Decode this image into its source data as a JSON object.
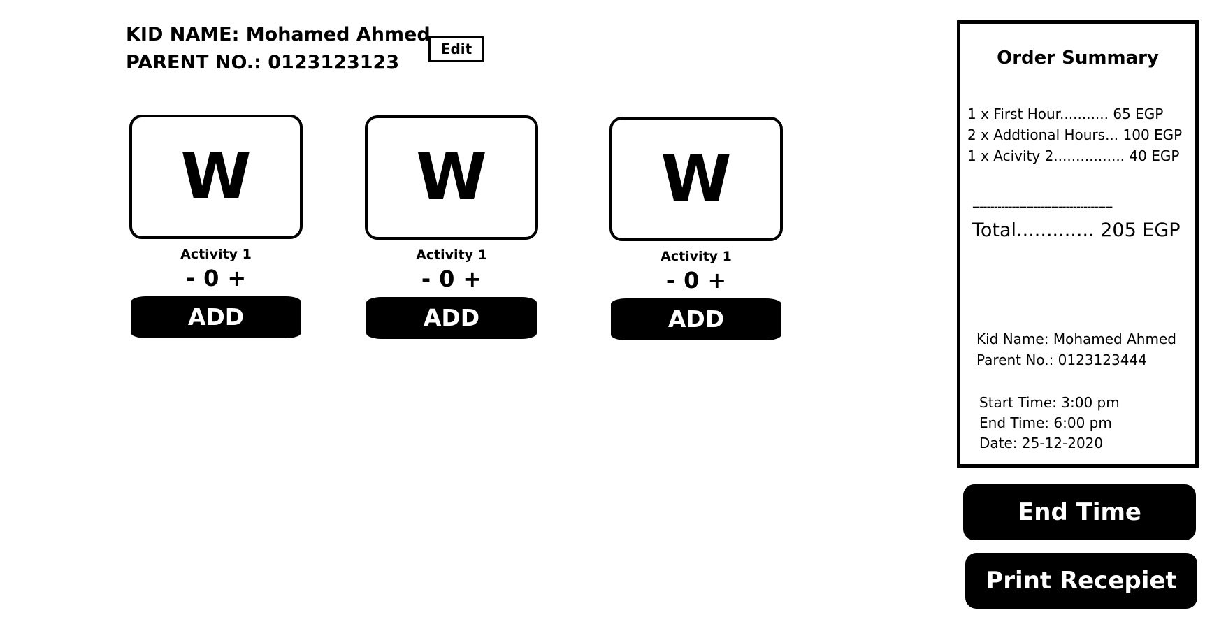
{
  "header": {
    "kid_name_line": "KID NAME: Mohamed Ahmed",
    "parent_no_line": "PARENT NO.: 0123123123",
    "edit_label": "Edit"
  },
  "activities": [
    {
      "icon": "W",
      "label": "Activity 1",
      "minus": "-",
      "count": "0",
      "plus": "+",
      "add_label": "ADD"
    },
    {
      "icon": "W",
      "label": "Activity 1",
      "minus": "-",
      "count": "0",
      "plus": "+",
      "add_label": "ADD"
    },
    {
      "icon": "W",
      "label": "Activity 1",
      "minus": "-",
      "count": "0",
      "plus": "+",
      "add_label": "ADD"
    }
  ],
  "summary": {
    "title": "Order Summary",
    "lines": [
      "1 x First Hour........... 65 EGP",
      "2 x Addtional Hours... 100 EGP",
      "1 x Acivity 2................ 40 EGP"
    ],
    "divider": "---------------------------------------",
    "total": "Total............. 205 EGP",
    "kid_name": "Kid Name: Mohamed Ahmed",
    "parent_no": "Parent No.: 0123123444",
    "start_time": "Start Time: 3:00 pm",
    "end_time": "End Time: 6:00 pm",
    "date": "Date: 25-12-2020"
  },
  "actions": {
    "end_time_label": "End Time",
    "print_label": "Print Recepiet"
  },
  "colors": {
    "foreground": "#000000",
    "background": "#ffffff"
  }
}
